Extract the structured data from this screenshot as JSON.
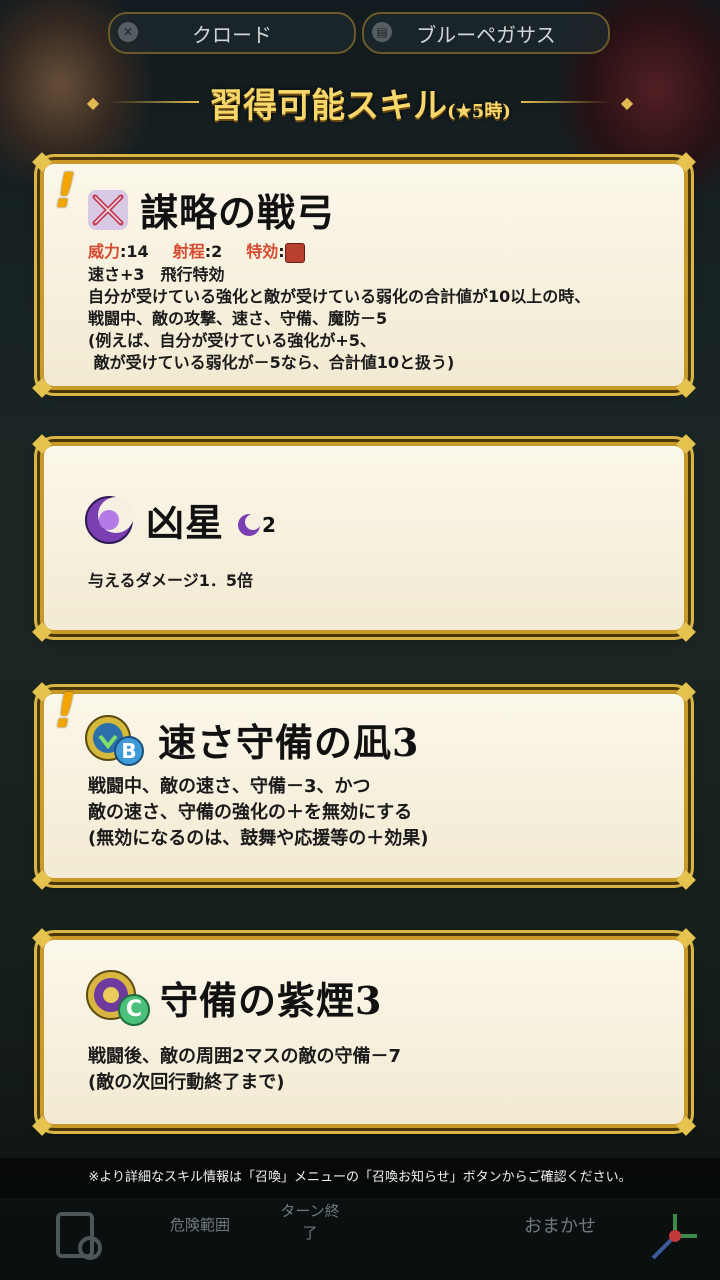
{
  "header": {
    "left_tab": "クロード",
    "right_tab": "ブルーペガサス"
  },
  "title": {
    "main": "習得可能スキル",
    "sub": "(★5時)"
  },
  "skills": [
    {
      "name": "謀略の戦弓",
      "stats": {
        "might_label": "威力",
        "might": "14",
        "range_label": "射程",
        "range": "2",
        "effective_label": "特効"
      },
      "lines": [
        "速さ+3　飛行特効",
        "自分が受けている強化と敵が受けている弱化の合計値が10以上の時、",
        "戦闘中、敵の攻撃、速さ、守備、魔防－5",
        "(例えば、自分が受けている強化が+5、",
        " 敵が受けている弱化が－5なら、合計値10と扱う)"
      ]
    },
    {
      "name": "凶星",
      "cooldown": "2",
      "lines": [
        "与えるダメージ1．5倍"
      ]
    },
    {
      "name": "速さ守備の凪3",
      "slot": "B",
      "lines": [
        "戦闘中、敵の速さ、守備－3、かつ",
        "敵の速さ、守備の強化の＋を無効にする",
        "(無効になるのは、鼓舞や応援等の＋効果)"
      ]
    },
    {
      "name": "守備の紫煙3",
      "slot": "C",
      "lines": [
        "戦闘後、敵の周囲2マスの敵の守備－7",
        "(敵の次回行動終了まで)"
      ]
    }
  ],
  "footer_note": "※より詳細なスキル情報は「召喚」メニューの「召喚お知らせ」ボタンからご確認ください。",
  "bottom_bar": {
    "danger": "危険範囲",
    "turn_end": "ターン終了",
    "auto": "おまかせ"
  },
  "colors": {
    "gold": "#e3ba50",
    "stat_label": "#d64a2f",
    "card_bg": "#fbf7ea"
  }
}
